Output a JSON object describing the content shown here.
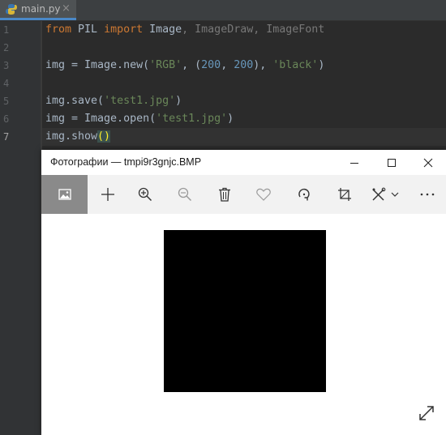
{
  "editor": {
    "tab": {
      "filename": "main.py",
      "close": "×"
    },
    "line_numbers": [
      "1",
      "2",
      "3",
      "4",
      "5",
      "6",
      "7"
    ],
    "lines": {
      "l1": {
        "from": "from",
        "module": " PIL ",
        "import": "import",
        "image": " Image",
        "rest": ", ImageDraw, ImageFont"
      },
      "l3": {
        "a": "img = Image.new(",
        "s1": "'RGB'",
        "b": ", (",
        "n1": "200",
        "c": ", ",
        "n2": "200",
        "d": "), ",
        "s2": "'black'",
        "e": ")"
      },
      "l5": {
        "a": "img.save(",
        "s": "'test1.jpg'",
        "b": ")"
      },
      "l6": {
        "a": "img = Image.open(",
        "s": "'test1.jpg'",
        "b": ")"
      },
      "l7": {
        "a": "img.show",
        "p": "()"
      }
    }
  },
  "photos_window": {
    "title": "Фотографии — tmpi9r3gnjc.BMP",
    "title_buttons": [
      "minimize-icon",
      "maximize-icon",
      "close-icon"
    ],
    "toolbar_icons": [
      "image-view-icon",
      "add-icon",
      "zoom-in-icon",
      "zoom-out-icon",
      "delete-icon",
      "favorite-heart-icon",
      "rotate-icon",
      "crop-icon",
      "edit-draw-icon",
      "chevron-down-icon",
      "more-icon"
    ],
    "image_fill": "#000000",
    "fullscreen_icon": "expand-icon"
  },
  "colors": {
    "keyword": "#cc7832",
    "string": "#6a8759",
    "number": "#6897bb",
    "identifier": "#a9b7c6",
    "unused_import": "#787878",
    "selected_tool": "#8a8a8a"
  }
}
